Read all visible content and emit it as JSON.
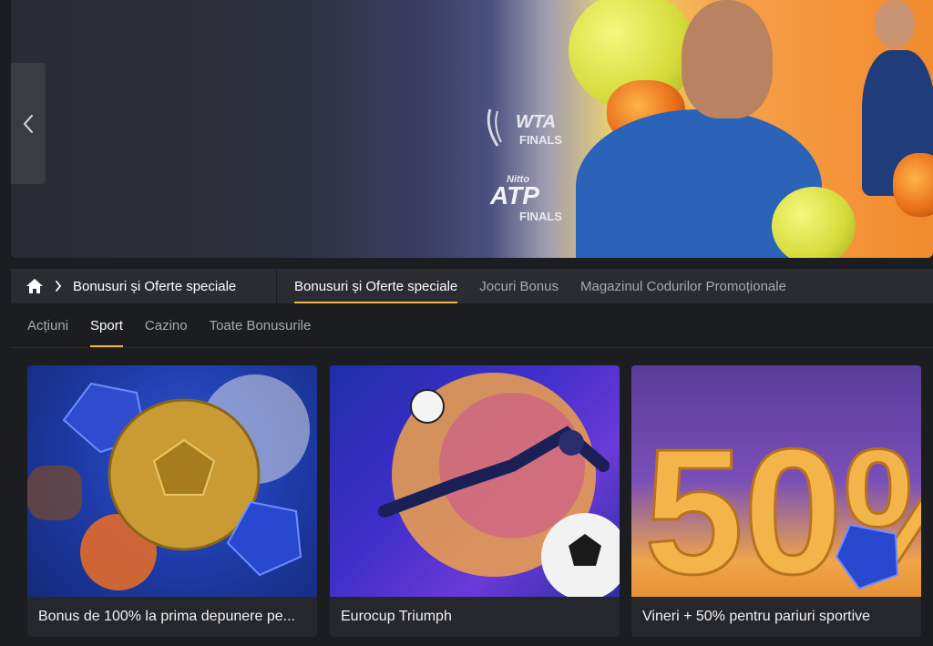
{
  "banner": {
    "wta_logo_text": "WTA",
    "wta_logo_sub": "FINALS",
    "atp_logo_top": "Nitto",
    "atp_logo_text": "ATP",
    "atp_logo_sub": "FINALS"
  },
  "nav": {
    "breadcrumb_label": "Bonusuri și Oferte speciale",
    "tabs": [
      {
        "label": "Bonusuri și Oferte speciale",
        "active": true
      },
      {
        "label": "Jocuri Bonus",
        "active": false
      },
      {
        "label": "Magazinul Codurilor Promoționale",
        "active": false
      }
    ]
  },
  "subtabs": [
    {
      "label": "Acțiuni",
      "active": false
    },
    {
      "label": "Sport",
      "active": true
    },
    {
      "label": "Cazino",
      "active": false
    },
    {
      "label": "Toate Bonusurile",
      "active": false
    }
  ],
  "cards": [
    {
      "title": "Bonus de 100% la prima depunere pe..."
    },
    {
      "title": "Eurocup Triumph"
    },
    {
      "title": "Vineri + 50% pentru pariuri sportive",
      "image_text": "50%"
    }
  ],
  "colors": {
    "accent": "#f0b540",
    "background": "#1c1d21",
    "nav_bg": "#2a2c31"
  }
}
